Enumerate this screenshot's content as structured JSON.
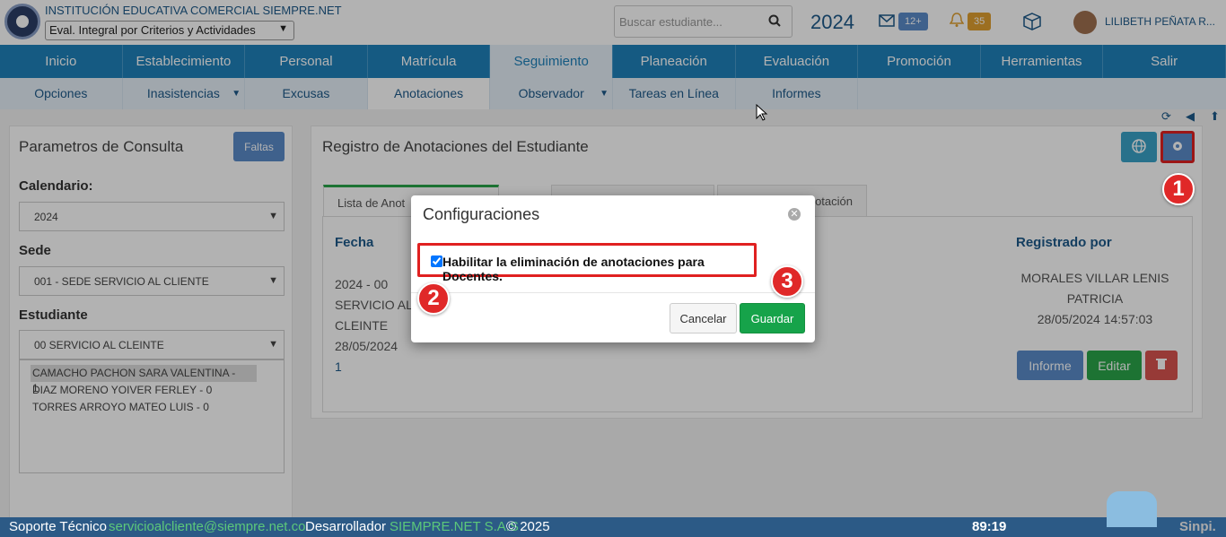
{
  "header": {
    "institution": "INSTITUCIÓN EDUCATIVA COMERCIAL SIEMPRE.NET",
    "mode_select": "Eval. Integral por Criterios y Actividades",
    "search_placeholder": "Buscar estudiante...",
    "year": "2024",
    "mail_badge": "12+",
    "notif_badge": "35",
    "user": "LILIBETH PEÑATA R..."
  },
  "nav": [
    "Inicio",
    "Establecimiento",
    "Personal",
    "Matrícula",
    "Seguimiento",
    "Planeación",
    "Evaluación",
    "Promoción",
    "Herramientas",
    "Salir"
  ],
  "subnav": [
    "Opciones",
    "Inasistencias",
    "Excusas",
    "Anotaciones",
    "Observador",
    "Tareas en Línea",
    "Informes"
  ],
  "left_panel": {
    "title": "Parametros de Consulta",
    "faltas_button": "Faltas",
    "calendario_label": "Calendario:",
    "calendario_value": "2024",
    "sede_label": "Sede",
    "sede_value": "001 - SEDE SERVICIO AL CLIENTE",
    "estudiante_label": "Estudiante",
    "estudiante_value": "00 SERVICIO AL CLEINTE",
    "students": [
      "CAMACHO PACHON SARA VALENTINA - 1",
      "DIAZ MORENO YOIVER FERLEY - 0",
      "TORRES ARROYO MATEO LUIS - 0"
    ]
  },
  "main_panel": {
    "title": "Registro de Anotaciones del Estudiante",
    "tab_list": "Lista de Anot",
    "tab_annot": "otación",
    "col_fecha": "Fecha",
    "col_registrado": "Registrado por",
    "row_fecha": [
      "2024  - 00",
      "SERVICIO AL",
      "CLEINTE",
      "28/05/2024"
    ],
    "row_num": "1",
    "row_registrado": [
      "MORALES VILLAR LENIS",
      "PATRICIA",
      "28/05/2024 14:57:03"
    ],
    "btn_informe": "Informe",
    "btn_editar": "Editar"
  },
  "modal": {
    "title": "Configuraciones",
    "checkbox_label": "Habilitar la eliminación de anotaciones para Docentes.",
    "cancel": "Cancelar",
    "save": "Guardar"
  },
  "markers": [
    "1",
    "2",
    "3"
  ],
  "footer": {
    "soporte": "Soporte Técnico",
    "email": "servicioalcliente@siempre.net.co",
    "dev": "Desarrollador",
    "company": "SIEMPRE.NET S.A.S",
    "copyright": "© 2025",
    "timer": "89:19",
    "brand": "Sinpi."
  }
}
